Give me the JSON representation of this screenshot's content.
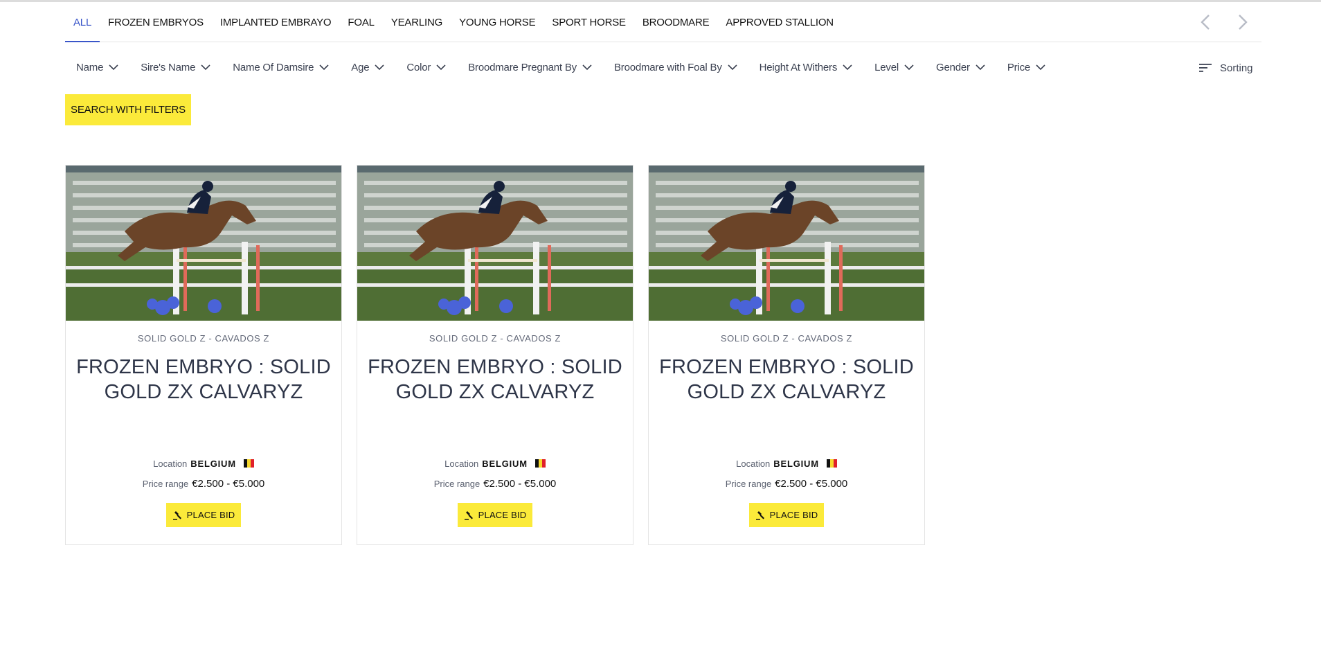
{
  "tabs": [
    {
      "label": "ALL",
      "active": true
    },
    {
      "label": "FROZEN EMBRYOS",
      "active": false
    },
    {
      "label": "IMPLANTED EMBRAYO",
      "active": false
    },
    {
      "label": "FOAL",
      "active": false
    },
    {
      "label": "YEARLING",
      "active": false
    },
    {
      "label": "YOUNG HORSE",
      "active": false
    },
    {
      "label": "SPORT HORSE",
      "active": false
    },
    {
      "label": "BROODMARE",
      "active": false
    },
    {
      "label": "APPROVED STALLION",
      "active": false
    }
  ],
  "filters": [
    {
      "label": "Name"
    },
    {
      "label": "Sire's Name"
    },
    {
      "label": "Name Of Damsire"
    },
    {
      "label": "Age"
    },
    {
      "label": "Color"
    },
    {
      "label": "Broodmare Pregnant By"
    },
    {
      "label": "Broodmare with Foal By"
    },
    {
      "label": "Height At Withers"
    },
    {
      "label": "Level"
    },
    {
      "label": "Gender"
    },
    {
      "label": "Price"
    }
  ],
  "sorting": {
    "label": "Sorting",
    "icon": "sort-lines-icon"
  },
  "search_button": {
    "label": "SEARCH WITH FILTERS"
  },
  "colors": {
    "accent": "#3a56c9",
    "button": "#fbea3a",
    "text": "#2e3548"
  },
  "listings": [
    {
      "breed": "SOLID GOLD Z - CAVADOS Z",
      "title": "FROZEN EMBRYO : SOLID GOLD ZX CALVARYZ",
      "location_label": "Location",
      "location": "BELGIUM",
      "price_label": "Price range",
      "price": "€2.500 - €5.000",
      "button": "PLACE BID",
      "image": "show-jumping-horse-photo"
    },
    {
      "breed": "SOLID GOLD Z - CAVADOS Z",
      "title": "FROZEN EMBRYO : SOLID GOLD ZX CALVARYZ",
      "location_label": "Location",
      "location": "BELGIUM",
      "price_label": "Price range",
      "price": "€2.500 - €5.000",
      "button": "PLACE BID",
      "image": "show-jumping-horse-photo"
    },
    {
      "breed": "SOLID GOLD Z - CAVADOS Z",
      "title": "FROZEN EMBRYO : SOLID GOLD ZX CALVARYZ",
      "location_label": "Location",
      "location": "BELGIUM",
      "price_label": "Price range",
      "price": "€2.500 - €5.000",
      "button": "PLACE BID",
      "image": "show-jumping-horse-photo"
    }
  ]
}
